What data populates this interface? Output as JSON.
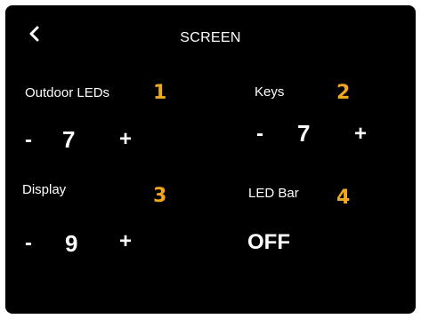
{
  "header": {
    "title": "SCREEN",
    "back_icon": "chevron-left-icon"
  },
  "settings": [
    {
      "label": "Outdoor LEDs",
      "badge": "1",
      "minus": "-",
      "value": "7",
      "plus": "+"
    },
    {
      "label": "Keys",
      "badge": "2",
      "minus": "-",
      "value": "7",
      "plus": "+"
    },
    {
      "label": "Display",
      "badge": "3",
      "minus": "-",
      "value": "9",
      "plus": "+"
    },
    {
      "label": "LED Bar",
      "badge": "4",
      "value": "OFF"
    }
  ],
  "colors": {
    "background": "#000000",
    "text": "#ffffff",
    "badge": "#f2a81d"
  }
}
